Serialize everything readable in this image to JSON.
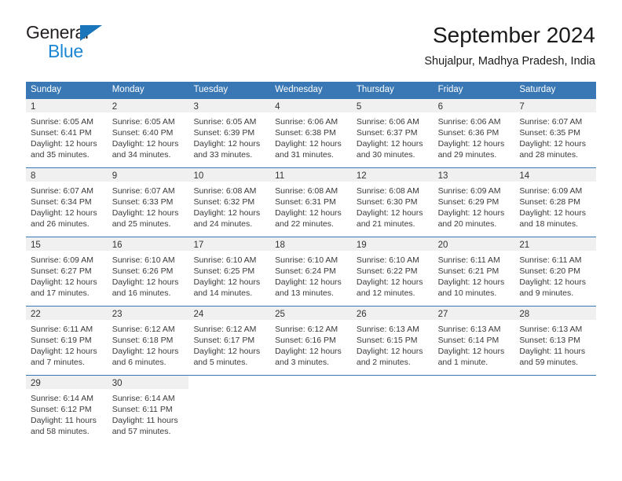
{
  "brand": {
    "name_part1": "General",
    "name_part2": "Blue",
    "triangle_color": "#1b75bb",
    "blue_text_color": "#1b87d4"
  },
  "header": {
    "title": "September 2024",
    "subtitle": "Shujalpur, Madhya Pradesh, India"
  },
  "colors": {
    "header_blue": "#3a78b5",
    "daynum_band": "#f0f0f0",
    "text": "#3a3a3a"
  },
  "weekdays": [
    "Sunday",
    "Monday",
    "Tuesday",
    "Wednesday",
    "Thursday",
    "Friday",
    "Saturday"
  ],
  "weeks": [
    [
      {
        "day": "1",
        "sunrise": "Sunrise: 6:05 AM",
        "sunset": "Sunset: 6:41 PM",
        "daylight1": "Daylight: 12 hours",
        "daylight2": "and 35 minutes."
      },
      {
        "day": "2",
        "sunrise": "Sunrise: 6:05 AM",
        "sunset": "Sunset: 6:40 PM",
        "daylight1": "Daylight: 12 hours",
        "daylight2": "and 34 minutes."
      },
      {
        "day": "3",
        "sunrise": "Sunrise: 6:05 AM",
        "sunset": "Sunset: 6:39 PM",
        "daylight1": "Daylight: 12 hours",
        "daylight2": "and 33 minutes."
      },
      {
        "day": "4",
        "sunrise": "Sunrise: 6:06 AM",
        "sunset": "Sunset: 6:38 PM",
        "daylight1": "Daylight: 12 hours",
        "daylight2": "and 31 minutes."
      },
      {
        "day": "5",
        "sunrise": "Sunrise: 6:06 AM",
        "sunset": "Sunset: 6:37 PM",
        "daylight1": "Daylight: 12 hours",
        "daylight2": "and 30 minutes."
      },
      {
        "day": "6",
        "sunrise": "Sunrise: 6:06 AM",
        "sunset": "Sunset: 6:36 PM",
        "daylight1": "Daylight: 12 hours",
        "daylight2": "and 29 minutes."
      },
      {
        "day": "7",
        "sunrise": "Sunrise: 6:07 AM",
        "sunset": "Sunset: 6:35 PM",
        "daylight1": "Daylight: 12 hours",
        "daylight2": "and 28 minutes."
      }
    ],
    [
      {
        "day": "8",
        "sunrise": "Sunrise: 6:07 AM",
        "sunset": "Sunset: 6:34 PM",
        "daylight1": "Daylight: 12 hours",
        "daylight2": "and 26 minutes."
      },
      {
        "day": "9",
        "sunrise": "Sunrise: 6:07 AM",
        "sunset": "Sunset: 6:33 PM",
        "daylight1": "Daylight: 12 hours",
        "daylight2": "and 25 minutes."
      },
      {
        "day": "10",
        "sunrise": "Sunrise: 6:08 AM",
        "sunset": "Sunset: 6:32 PM",
        "daylight1": "Daylight: 12 hours",
        "daylight2": "and 24 minutes."
      },
      {
        "day": "11",
        "sunrise": "Sunrise: 6:08 AM",
        "sunset": "Sunset: 6:31 PM",
        "daylight1": "Daylight: 12 hours",
        "daylight2": "and 22 minutes."
      },
      {
        "day": "12",
        "sunrise": "Sunrise: 6:08 AM",
        "sunset": "Sunset: 6:30 PM",
        "daylight1": "Daylight: 12 hours",
        "daylight2": "and 21 minutes."
      },
      {
        "day": "13",
        "sunrise": "Sunrise: 6:09 AM",
        "sunset": "Sunset: 6:29 PM",
        "daylight1": "Daylight: 12 hours",
        "daylight2": "and 20 minutes."
      },
      {
        "day": "14",
        "sunrise": "Sunrise: 6:09 AM",
        "sunset": "Sunset: 6:28 PM",
        "daylight1": "Daylight: 12 hours",
        "daylight2": "and 18 minutes."
      }
    ],
    [
      {
        "day": "15",
        "sunrise": "Sunrise: 6:09 AM",
        "sunset": "Sunset: 6:27 PM",
        "daylight1": "Daylight: 12 hours",
        "daylight2": "and 17 minutes."
      },
      {
        "day": "16",
        "sunrise": "Sunrise: 6:10 AM",
        "sunset": "Sunset: 6:26 PM",
        "daylight1": "Daylight: 12 hours",
        "daylight2": "and 16 minutes."
      },
      {
        "day": "17",
        "sunrise": "Sunrise: 6:10 AM",
        "sunset": "Sunset: 6:25 PM",
        "daylight1": "Daylight: 12 hours",
        "daylight2": "and 14 minutes."
      },
      {
        "day": "18",
        "sunrise": "Sunrise: 6:10 AM",
        "sunset": "Sunset: 6:24 PM",
        "daylight1": "Daylight: 12 hours",
        "daylight2": "and 13 minutes."
      },
      {
        "day": "19",
        "sunrise": "Sunrise: 6:10 AM",
        "sunset": "Sunset: 6:22 PM",
        "daylight1": "Daylight: 12 hours",
        "daylight2": "and 12 minutes."
      },
      {
        "day": "20",
        "sunrise": "Sunrise: 6:11 AM",
        "sunset": "Sunset: 6:21 PM",
        "daylight1": "Daylight: 12 hours",
        "daylight2": "and 10 minutes."
      },
      {
        "day": "21",
        "sunrise": "Sunrise: 6:11 AM",
        "sunset": "Sunset: 6:20 PM",
        "daylight1": "Daylight: 12 hours",
        "daylight2": "and 9 minutes."
      }
    ],
    [
      {
        "day": "22",
        "sunrise": "Sunrise: 6:11 AM",
        "sunset": "Sunset: 6:19 PM",
        "daylight1": "Daylight: 12 hours",
        "daylight2": "and 7 minutes."
      },
      {
        "day": "23",
        "sunrise": "Sunrise: 6:12 AM",
        "sunset": "Sunset: 6:18 PM",
        "daylight1": "Daylight: 12 hours",
        "daylight2": "and 6 minutes."
      },
      {
        "day": "24",
        "sunrise": "Sunrise: 6:12 AM",
        "sunset": "Sunset: 6:17 PM",
        "daylight1": "Daylight: 12 hours",
        "daylight2": "and 5 minutes."
      },
      {
        "day": "25",
        "sunrise": "Sunrise: 6:12 AM",
        "sunset": "Sunset: 6:16 PM",
        "daylight1": "Daylight: 12 hours",
        "daylight2": "and 3 minutes."
      },
      {
        "day": "26",
        "sunrise": "Sunrise: 6:13 AM",
        "sunset": "Sunset: 6:15 PM",
        "daylight1": "Daylight: 12 hours",
        "daylight2": "and 2 minutes."
      },
      {
        "day": "27",
        "sunrise": "Sunrise: 6:13 AM",
        "sunset": "Sunset: 6:14 PM",
        "daylight1": "Daylight: 12 hours",
        "daylight2": "and 1 minute."
      },
      {
        "day": "28",
        "sunrise": "Sunrise: 6:13 AM",
        "sunset": "Sunset: 6:13 PM",
        "daylight1": "Daylight: 11 hours",
        "daylight2": "and 59 minutes."
      }
    ],
    [
      {
        "day": "29",
        "sunrise": "Sunrise: 6:14 AM",
        "sunset": "Sunset: 6:12 PM",
        "daylight1": "Daylight: 11 hours",
        "daylight2": "and 58 minutes."
      },
      {
        "day": "30",
        "sunrise": "Sunrise: 6:14 AM",
        "sunset": "Sunset: 6:11 PM",
        "daylight1": "Daylight: 11 hours",
        "daylight2": "and 57 minutes."
      },
      {
        "day": "",
        "sunrise": "",
        "sunset": "",
        "daylight1": "",
        "daylight2": ""
      },
      {
        "day": "",
        "sunrise": "",
        "sunset": "",
        "daylight1": "",
        "daylight2": ""
      },
      {
        "day": "",
        "sunrise": "",
        "sunset": "",
        "daylight1": "",
        "daylight2": ""
      },
      {
        "day": "",
        "sunrise": "",
        "sunset": "",
        "daylight1": "",
        "daylight2": ""
      },
      {
        "day": "",
        "sunrise": "",
        "sunset": "",
        "daylight1": "",
        "daylight2": ""
      }
    ]
  ]
}
